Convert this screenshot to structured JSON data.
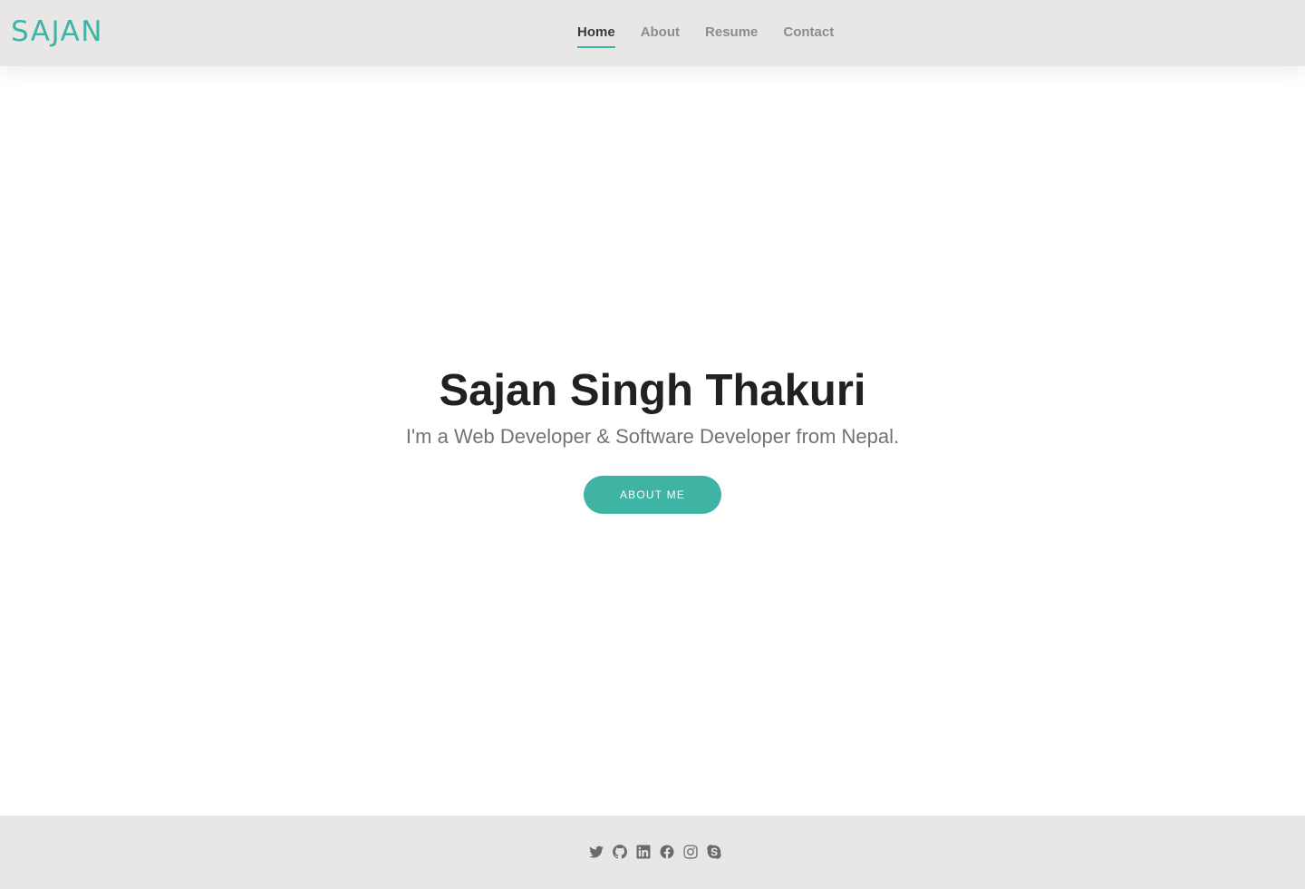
{
  "header": {
    "logo": "SAJAN",
    "nav": [
      {
        "label": "Home",
        "active": true
      },
      {
        "label": "About",
        "active": false
      },
      {
        "label": "Resume",
        "active": false
      },
      {
        "label": "Contact",
        "active": false
      }
    ]
  },
  "hero": {
    "name": "Sajan Singh Thakuri",
    "tagline": "I'm a Web Developer & Software Developer from Nepal.",
    "button_label": "ABOUT ME"
  },
  "footer": {
    "social_icons": [
      "twitter-icon",
      "github-icon",
      "linkedin-icon",
      "facebook-icon",
      "instagram-icon",
      "skype-icon"
    ]
  },
  "colors": {
    "accent": "#3fb4a4",
    "header_bg": "#e8e7e5",
    "footer_bg": "#e8e7e5",
    "heading_text": "#212121",
    "muted_text": "#737373",
    "nav_inactive": "#8d8c8a",
    "icon": "#6b6b6b"
  }
}
